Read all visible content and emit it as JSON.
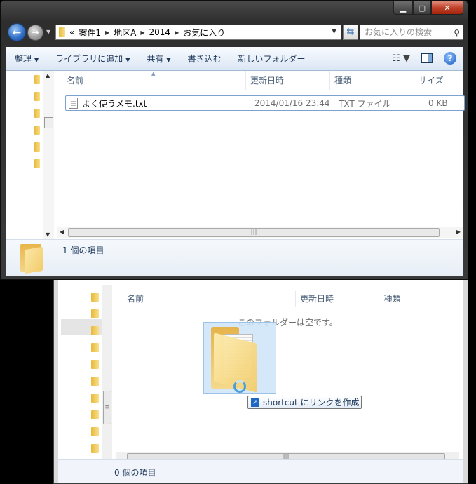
{
  "main_window": {
    "breadcrumb": {
      "overflow": "«",
      "segments": [
        "案件1",
        "地区A",
        "2014",
        "お気に入り"
      ]
    },
    "search_placeholder": "お気に入りの検索",
    "toolbar": {
      "organize": "整理",
      "add_to_library": "ライブラリに追加",
      "share": "共有",
      "burn": "書き込む",
      "new_folder": "新しいフォルダー"
    },
    "columns": {
      "name": "名前",
      "date": "更新日時",
      "type": "種類",
      "size": "サイズ"
    },
    "files": [
      {
        "name": "よく使うメモ.txt",
        "date": "2014/01/16 23:44",
        "type": "TXT ファイル",
        "size": "0 KB"
      }
    ],
    "status_text": "1 個の項目"
  },
  "second_window": {
    "columns": {
      "name": "名前",
      "date": "更新日時",
      "type": "種類"
    },
    "empty_message": "このフォルダーは空です。",
    "status_text": "0 個の項目"
  },
  "drag": {
    "tooltip_text": "shortcut にリンクを作成"
  },
  "icons": [
    "back-arrow-icon",
    "forward-arrow-icon",
    "folder-icon",
    "refresh-icon",
    "search-icon",
    "views-icon",
    "preview-pane-icon",
    "help-icon",
    "text-file-icon",
    "link-arrow-icon"
  ]
}
